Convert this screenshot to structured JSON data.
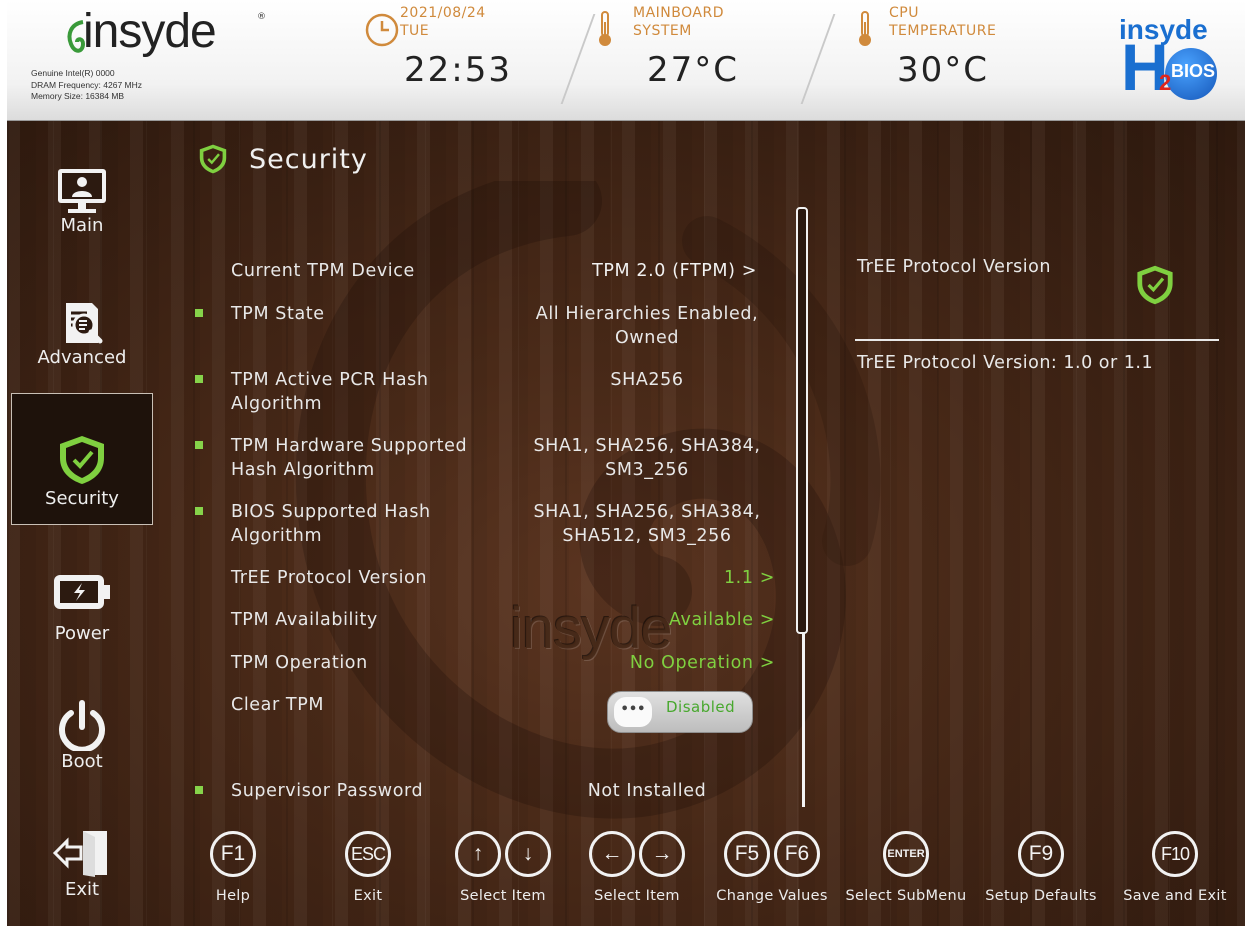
{
  "header": {
    "logo_text": "insyde",
    "system_info": [
      "Genuine Intel(R) 0000",
      "DRAM Frequency: 4267 MHz",
      "Memory Size: 16384 MB"
    ],
    "date": "2021/08/24",
    "weekday": "TUE",
    "time": "22:53",
    "mainboard_label_1": "MAINBOARD",
    "mainboard_label_2": "SYSTEM",
    "mainboard_temp": "27°C",
    "cpu_label_1": "CPU",
    "cpu_label_2": "TEMPERATURE",
    "cpu_temp": "30°C",
    "brand_top": "insyde",
    "brand_h": "H",
    "brand_sub": "2",
    "brand_bios": "BIOS"
  },
  "sidebar": {
    "items": [
      {
        "label": "Main",
        "icon": "monitor-user-icon",
        "active": false
      },
      {
        "label": "Advanced",
        "icon": "document-magnifier-icon",
        "active": false
      },
      {
        "label": "Security",
        "icon": "shield-check-icon",
        "active": true
      },
      {
        "label": "Power",
        "icon": "battery-icon",
        "active": false
      },
      {
        "label": "Boot",
        "icon": "power-icon",
        "active": false
      },
      {
        "label": "Exit",
        "icon": "exit-door-icon",
        "active": false
      }
    ]
  },
  "page": {
    "title": "Security",
    "watermark": "insyde"
  },
  "settings": [
    {
      "label": "Current TPM Device",
      "value": "TPM 2.0 (FTPM) >",
      "bullet": false
    },
    {
      "label": "TPM State",
      "value": "All Hierarchies Enabled, Owned",
      "bullet": true
    },
    {
      "label": "TPM Active PCR Hash Algorithm",
      "value": "SHA256",
      "bullet": true
    },
    {
      "label": "TPM Hardware Supported Hash Algorithm",
      "value": "SHA1, SHA256, SHA384, SM3_256",
      "bullet": true
    },
    {
      "label": "BIOS Supported Hash Algorithm",
      "value": "SHA1, SHA256, SHA384, SHA512, SM3_256",
      "bullet": true
    },
    {
      "label": "TrEE Protocol Version",
      "value": "1.1 >",
      "bullet": false
    },
    {
      "label": "TPM Availability",
      "value": "Available >",
      "bullet": false
    },
    {
      "label": "TPM Operation",
      "value": "No Operation >",
      "bullet": false
    },
    {
      "label": "Clear TPM",
      "value": "Disabled",
      "knob": "•••",
      "bullet": false
    },
    {
      "label": "Supervisor Password",
      "value": "Not Installed",
      "bullet": true
    }
  ],
  "help": {
    "title": "TrEE Protocol Version",
    "text": "TrEE Protocol Version: 1.0 or 1.1"
  },
  "footer": {
    "keys": [
      {
        "keys": [
          "F1"
        ],
        "label": "Help"
      },
      {
        "keys": [
          "ESC"
        ],
        "label": "Exit"
      },
      {
        "keys": [
          "↑",
          "↓"
        ],
        "label": "Select Item"
      },
      {
        "keys": [
          "←",
          "→"
        ],
        "label": "Select Item"
      },
      {
        "keys": [
          "F5",
          "F6"
        ],
        "label": "Change Values"
      },
      {
        "keys": [
          "ENTER"
        ],
        "label": "Select SubMenu"
      },
      {
        "keys": [
          "F9"
        ],
        "label": "Setup Defaults"
      },
      {
        "keys": [
          "F10"
        ],
        "label": "Save and Exit"
      }
    ]
  },
  "colors": {
    "accent_green": "#7fd040",
    "header_orange": "#d08a3c",
    "wood_dark": "#3b2113"
  }
}
